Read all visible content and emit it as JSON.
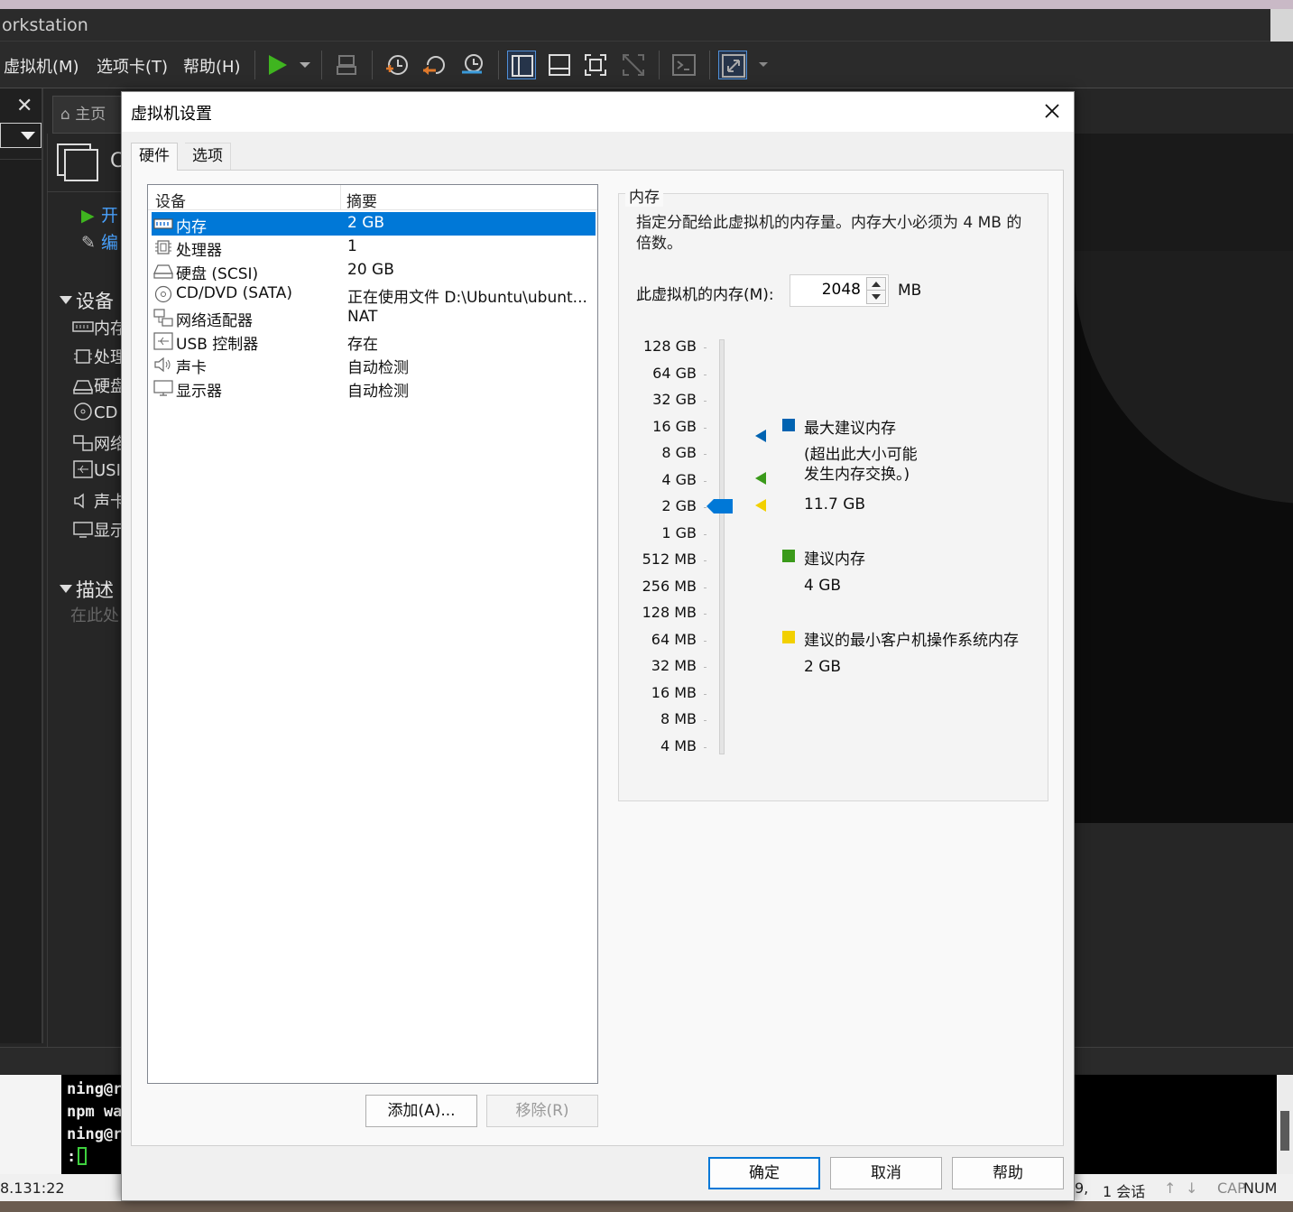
{
  "app": {
    "title": "orkstation",
    "menu": [
      "虚拟机(M)",
      "选项卡(T)",
      "帮助(H)"
    ],
    "home_tab": "主页",
    "vm_name_stub": "C",
    "actions": [
      "开",
      "编"
    ],
    "sections": {
      "devices": "设备",
      "description": "描述"
    },
    "device_stubs": [
      "内存",
      "处理",
      "硬盘",
      "CD",
      "网络",
      "USI",
      "声卡",
      "显示"
    ],
    "description_hint": "在此处",
    "terminal_lines": [
      "ning@r",
      "npm wa",
      "ning@r",
      ":"
    ],
    "status": {
      "ip": "8.131:22",
      "num": "9,",
      "sessions": "1 会话",
      "caps": "CAP",
      "numlock": "NUM"
    }
  },
  "dialog": {
    "title": "虚拟机设置",
    "tabs": [
      "硬件",
      "选项"
    ],
    "list_headers": {
      "device": "设备",
      "summary": "摘要"
    },
    "devices": [
      {
        "name": "内存",
        "summary": "2 GB",
        "icon": "memory-icon",
        "selected": true
      },
      {
        "name": "处理器",
        "summary": "1",
        "icon": "cpu-icon"
      },
      {
        "name": "硬盘 (SCSI)",
        "summary": "20 GB",
        "icon": "harddisk-icon"
      },
      {
        "name": "CD/DVD (SATA)",
        "summary": "正在使用文件 D:\\Ubuntu\\ubunt...",
        "icon": "cdrom-icon"
      },
      {
        "name": "网络适配器",
        "summary": "NAT",
        "icon": "network-icon"
      },
      {
        "name": "USB 控制器",
        "summary": "存在",
        "icon": "usb-icon"
      },
      {
        "name": "声卡",
        "summary": "自动检测",
        "icon": "speaker-icon"
      },
      {
        "name": "显示器",
        "summary": "自动检测",
        "icon": "monitor-icon"
      }
    ],
    "buttons": {
      "add": "添加(A)...",
      "remove": "移除(R)",
      "ok": "确定",
      "cancel": "取消",
      "help": "帮助"
    },
    "memory": {
      "group_title": "内存",
      "description": "指定分配给此虚拟机的内存量。内存大小必须为 4 MB 的倍数。",
      "label": "此虚拟机的内存(M):",
      "value": "2048",
      "unit": "MB",
      "scale": [
        "128 GB",
        "64 GB",
        "32 GB",
        "16 GB",
        "8 GB",
        "4 GB",
        "2 GB",
        "1 GB",
        "512 MB",
        "256 MB",
        "128 MB",
        "64 MB",
        "32 MB",
        "16 MB",
        "8 MB",
        "4 MB"
      ],
      "max_recommended": {
        "title": "最大建议内存",
        "note": "(超出此大小可能\n发生内存交换。)",
        "value": "11.7 GB",
        "color": "#0063b1"
      },
      "recommended": {
        "title": "建议内存",
        "value": "4 GB",
        "color": "#3a9a1a"
      },
      "min_guest": {
        "title": "建议的最小客户机操作系统内存",
        "value": "2 GB",
        "color": "#f2d000"
      },
      "slider_color": "#0078d7"
    }
  }
}
